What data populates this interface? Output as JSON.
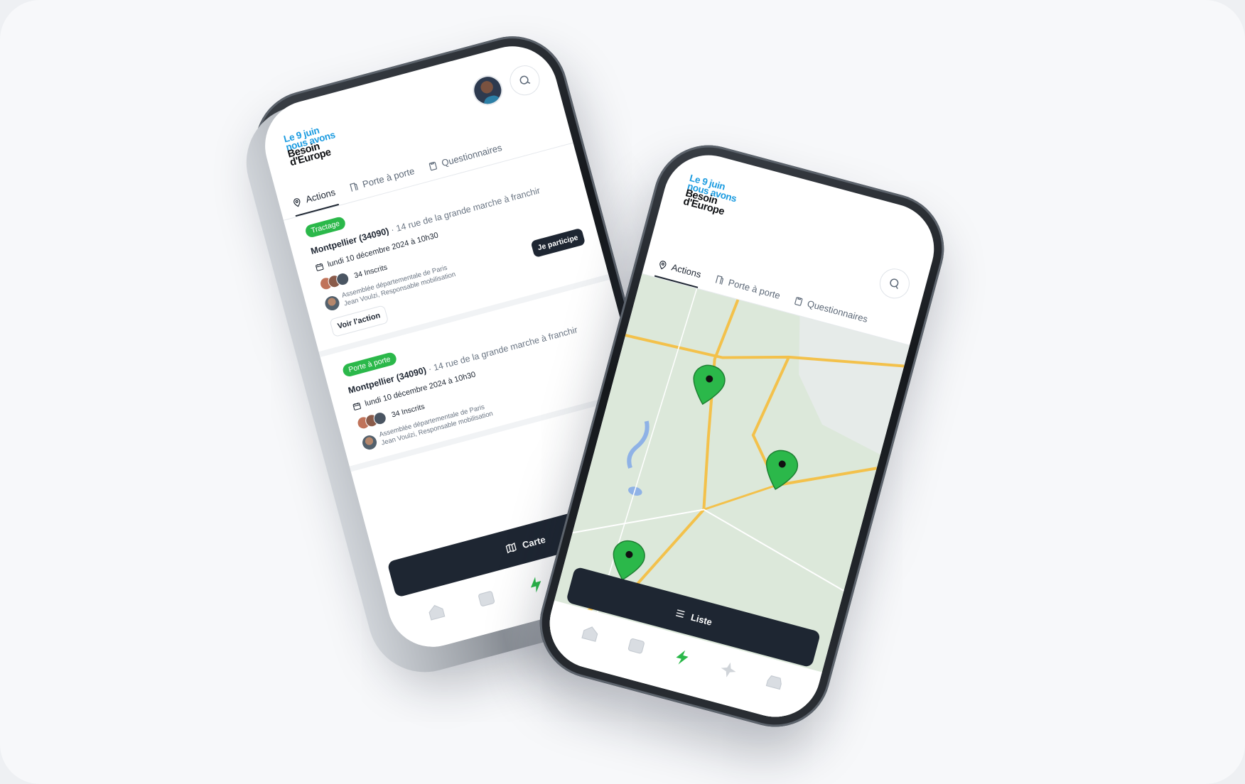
{
  "brand": {
    "logo_line1": "Le 9 juin",
    "logo_line2": "nous avons",
    "logo_line3": "Besoin",
    "logo_line4": "d'Europe",
    "accent_blue": "#1b9be0",
    "accent_green": "#2bb84a",
    "dark": "#1e2632"
  },
  "tabs": [
    {
      "label": "Actions",
      "icon": "location-pin-icon",
      "active": true
    },
    {
      "label": "Porte à porte",
      "icon": "door-icon",
      "active": false
    },
    {
      "label": "Questionnaires",
      "icon": "clipboard-icon",
      "active": false
    }
  ],
  "list_screen": {
    "cards": [
      {
        "badge": "Tractage",
        "city": "Montpellier (34090)",
        "street": " · 14 rue de la grande marche à franchir",
        "date": "lundi 10 décembre 2024 à 10h30",
        "attendees": "34 Inscrits",
        "org_name": "Assemblée départementale de Paris",
        "org_person": "Jean Voulzi, Responsable mobilisation",
        "participate_label": "Je participe",
        "view_label": "Voir l'action"
      },
      {
        "badge": "Porte à porte",
        "city": "Montpellier (34090)",
        "street": " · 14 rue de la grande marche à franchir",
        "date": "lundi 10 décembre 2024 à 10h30",
        "attendees": "34 Inscrits",
        "org_name": "Assemblée départementale de Paris",
        "org_person": "Jean Voulzi, Responsable mobilisation",
        "participate_label": "",
        "view_label": ""
      }
    ],
    "float_button": "Carte",
    "float_icon": "map-icon"
  },
  "map_screen": {
    "float_button": "Liste",
    "float_icon": "list-icon",
    "markers": 3
  },
  "bottom_nav": [
    {
      "icon": "home-icon",
      "active": false
    },
    {
      "icon": "calendar-icon",
      "active": false
    },
    {
      "icon": "lightning-icon",
      "active": true
    },
    {
      "icon": "sparkle-icon",
      "active": false
    },
    {
      "icon": "inbox-icon",
      "active": false
    }
  ]
}
